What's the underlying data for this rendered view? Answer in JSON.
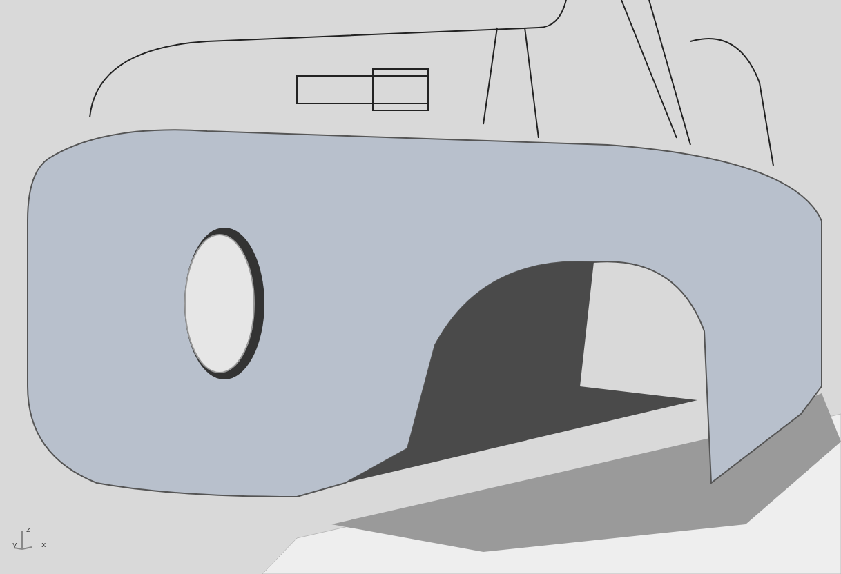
{
  "viewport": {
    "axes": {
      "z": "z",
      "y": "y",
      "x": "x"
    }
  }
}
